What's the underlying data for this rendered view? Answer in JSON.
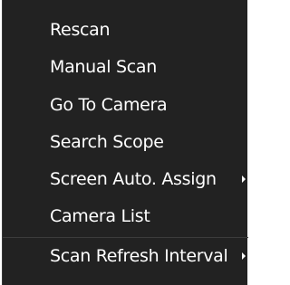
{
  "context_menu": {
    "items": [
      {
        "label": "Rescan",
        "has_submenu": false
      },
      {
        "label": "Manual Scan",
        "has_submenu": false
      },
      {
        "label": "Go To Camera",
        "has_submenu": false
      },
      {
        "label": "Search Scope",
        "has_submenu": false
      },
      {
        "label": "Screen Auto. Assign",
        "has_submenu": true,
        "submenu_icon": "chevron-right-icon"
      },
      {
        "label": "Camera List",
        "has_submenu": false
      },
      {
        "label": "Scan Refresh Interval",
        "has_submenu": true,
        "submenu_icon": "chevron-right-icon"
      }
    ]
  },
  "colors": {
    "menu_background": "#222222",
    "text": "#ffffff",
    "separator": "#3c3c3c"
  }
}
